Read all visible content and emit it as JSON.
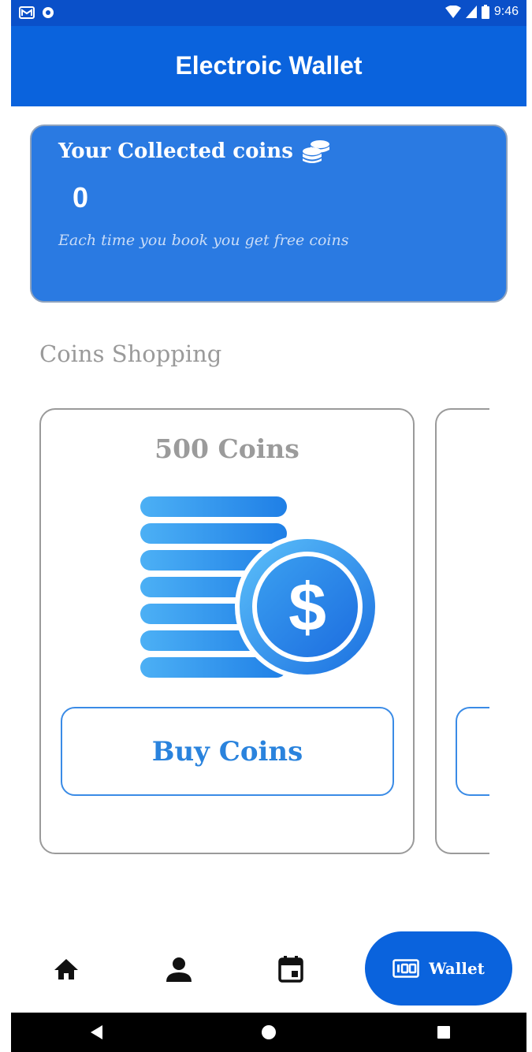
{
  "status_bar": {
    "time": "9:46"
  },
  "app_bar": {
    "title": "Electroic Wallet"
  },
  "coins_card": {
    "title": "Your Collected coins",
    "count": "0",
    "subtitle": "Each time you book you get free coins",
    "icon": "coins-stack-icon"
  },
  "shop": {
    "title": "Coins Shopping",
    "offers": [
      {
        "title": "500 Coins",
        "button": "Buy Coins",
        "image": "coin-stack-dollar-image"
      }
    ]
  },
  "bottom_nav": {
    "items": [
      {
        "icon": "home-icon"
      },
      {
        "icon": "person-icon"
      },
      {
        "icon": "calendar-icon"
      },
      {
        "icon": "wallet-icon",
        "label": "Wallet",
        "active": true
      }
    ]
  },
  "colors": {
    "primary": "#0a63dd",
    "card_blue": "#2a7ae2",
    "accent": "#3a8be6",
    "muted_text": "#9a9a9a"
  }
}
